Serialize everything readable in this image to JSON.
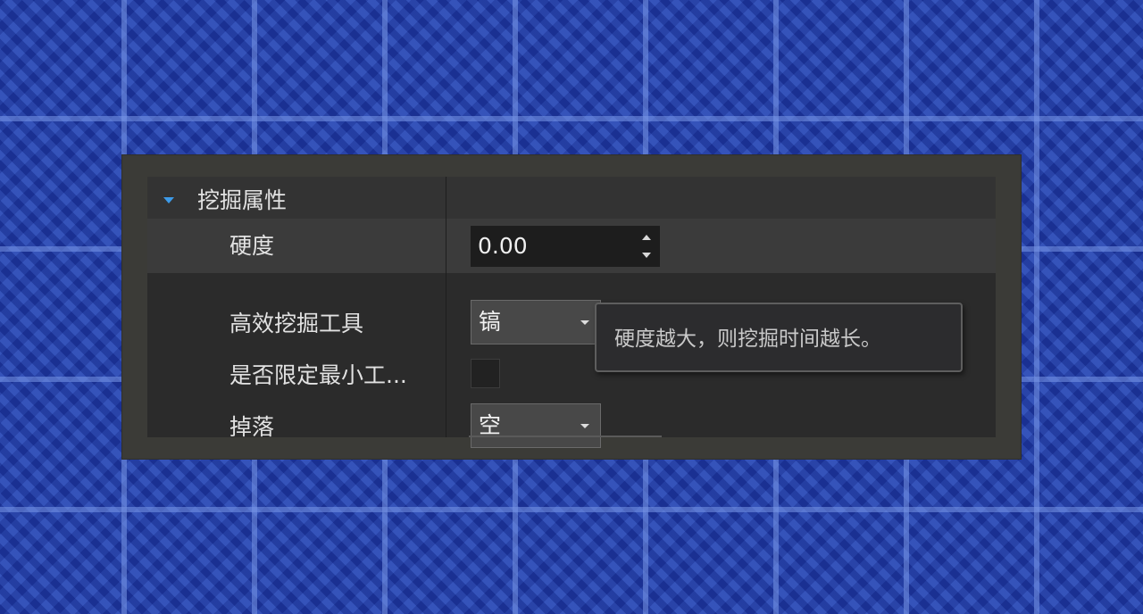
{
  "section": {
    "title": "挖掘属性",
    "expanded": true
  },
  "properties": {
    "hardness": {
      "label": "硬度",
      "value": "0.00"
    },
    "efficient_tool": {
      "label": "高效挖掘工具",
      "value": "镐"
    },
    "limit_min_tool": {
      "label": "是否限定最小工...",
      "checked": false
    },
    "drop": {
      "label": "掉落",
      "value": "空"
    }
  },
  "tooltip": {
    "text": "硬度越大，则挖掘时间越长。"
  },
  "colors": {
    "accent": "#3d9be9",
    "panel_bg": "#2b2b2b"
  }
}
